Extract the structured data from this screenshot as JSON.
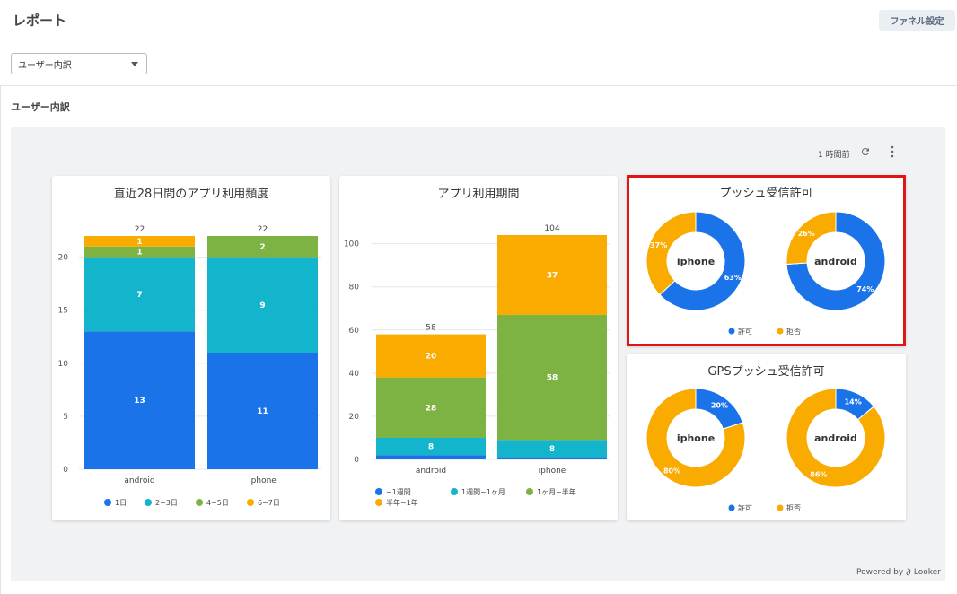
{
  "header": {
    "title": "レポート",
    "funnel_button": "ファネル設定"
  },
  "filter": {
    "selected": "ユーザー内訳"
  },
  "section": {
    "title": "ユーザー内訳"
  },
  "dashboard": {
    "updated": "1 時間前",
    "powered_by": "Powered by",
    "brand": "Looker"
  },
  "colors": {
    "blue": "#1a73e8",
    "teal": "#12b5cb",
    "green": "#7cb342",
    "orange": "#f9ab00"
  },
  "chart_data": [
    {
      "type": "bar",
      "stacked": true,
      "title": "直近28日間のアプリ利用頻度",
      "categories": [
        "android",
        "iphone"
      ],
      "series": [
        {
          "name": "1日",
          "values": [
            13,
            11
          ]
        },
        {
          "name": "2~3日",
          "values": [
            7,
            9
          ]
        },
        {
          "name": "4~5日",
          "values": [
            1,
            2
          ]
        },
        {
          "name": "6~7日",
          "values": [
            1,
            0
          ]
        }
      ],
      "totals": [
        22,
        22
      ],
      "ylim": [
        0,
        22
      ],
      "yticks": [
        0,
        5,
        10,
        15,
        20
      ],
      "legend": "bottom"
    },
    {
      "type": "bar",
      "stacked": true,
      "title": "アプリ利用期間",
      "categories": [
        "android",
        "iphone"
      ],
      "series": [
        {
          "name": "~1週間",
          "values": [
            2,
            1
          ]
        },
        {
          "name": "1週間~1ヶ月",
          "values": [
            8,
            8
          ]
        },
        {
          "name": "1ヶ月~半年",
          "values": [
            28,
            58
          ]
        },
        {
          "name": "半年~1年",
          "values": [
            20,
            37
          ]
        }
      ],
      "totals": [
        58,
        104
      ],
      "ylim": [
        0,
        104
      ],
      "yticks": [
        0,
        20,
        40,
        60,
        80,
        100
      ],
      "legend": "bottom"
    },
    {
      "type": "pie",
      "donut": true,
      "title": "プッシュ受信許可",
      "pies": [
        {
          "name": "iphone",
          "slices": [
            63,
            37
          ]
        },
        {
          "name": "android",
          "slices": [
            74,
            26
          ]
        }
      ],
      "labels": [
        "許可",
        "拒否"
      ],
      "legend": "bottom"
    },
    {
      "type": "pie",
      "donut": true,
      "title": "GPSプッシュ受信許可",
      "pies": [
        {
          "name": "iphone",
          "slices": [
            20,
            80
          ]
        },
        {
          "name": "android",
          "slices": [
            14,
            86
          ]
        }
      ],
      "labels": [
        "許可",
        "拒否"
      ],
      "legend": "bottom"
    }
  ]
}
